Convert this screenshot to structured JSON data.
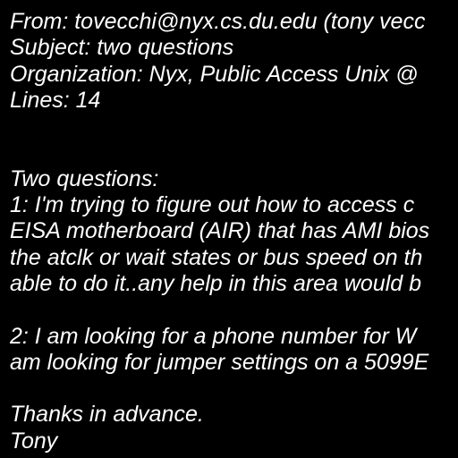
{
  "colors": {
    "background": "#000000",
    "text": "#ffffff"
  },
  "header": {
    "from": "From: tovecchi@nyx.cs.du.edu (tony vecc",
    "subject": "Subject: two questions",
    "organization": "Organization: Nyx, Public Access Unix @",
    "lines": "Lines: 14"
  },
  "body": {
    "intro": "Two questions:",
    "q1_line1": "1: I'm trying to figure out how to access c",
    "q1_line2": "EISA motherboard (AIR) that has AMI bios",
    "q1_line3": "the atclk or wait states or bus speed on th",
    "q1_line4": "able to do it..any help in this area would b",
    "q2_line1": "2: I am looking for a phone number for W",
    "q2_line2": "am looking for jumper settings on a 5099E",
    "closing": "Thanks in advance.",
    "signature": "Tony"
  }
}
